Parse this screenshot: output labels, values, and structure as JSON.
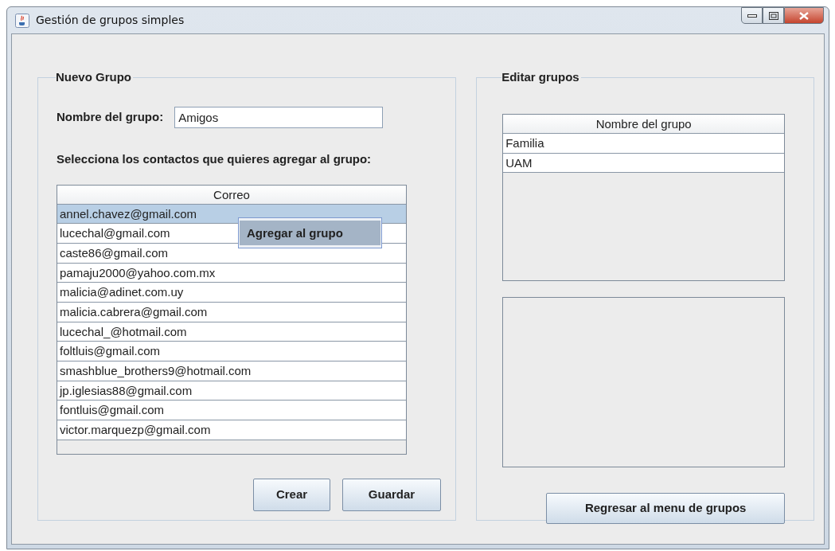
{
  "window": {
    "title": "Gestión de grupos simples"
  },
  "new_group": {
    "title": "Nuevo Grupo",
    "name_label": "Nombre del grupo:",
    "name_value": "Amigos",
    "instruction": "Selecciona los contactos que quieres agregar al grupo:",
    "contacts_table": {
      "columns": [
        "Correo"
      ],
      "rows": [
        {
          "email": "annel.chavez@gmail.com",
          "selected": true
        },
        {
          "email": "lucechal@gmail.com",
          "selected": false
        },
        {
          "email": "caste86@gmail.com",
          "selected": false
        },
        {
          "email": "pamaju2000@yahoo.com.mx",
          "selected": false
        },
        {
          "email": "malicia@adinet.com.uy",
          "selected": false
        },
        {
          "email": "malicia.cabrera@gmail.com",
          "selected": false
        },
        {
          "email": "lucechal_@hotmail.com",
          "selected": false
        },
        {
          "email": "foltluis@gmail.com",
          "selected": false
        },
        {
          "email": "smashblue_brothers9@hotmail.com",
          "selected": false
        },
        {
          "email": "jp.iglesias88@gmail.com",
          "selected": false
        },
        {
          "email": "fontluis@gmail.com",
          "selected": false
        },
        {
          "email": "victor.marquezp@gmail.com",
          "selected": false
        }
      ]
    },
    "context_menu": {
      "items": [
        "Agregar al grupo"
      ]
    },
    "buttons": [
      "Crear",
      "Guardar"
    ]
  },
  "edit_groups": {
    "title": "Editar grupos",
    "groups_table": {
      "columns": [
        "Nombre del grupo"
      ],
      "rows": [
        {
          "name": "Familia",
          "selected": false
        },
        {
          "name": "UAM",
          "selected": false
        }
      ]
    },
    "buttons": [
      "Regresar al menu de grupos"
    ]
  }
}
